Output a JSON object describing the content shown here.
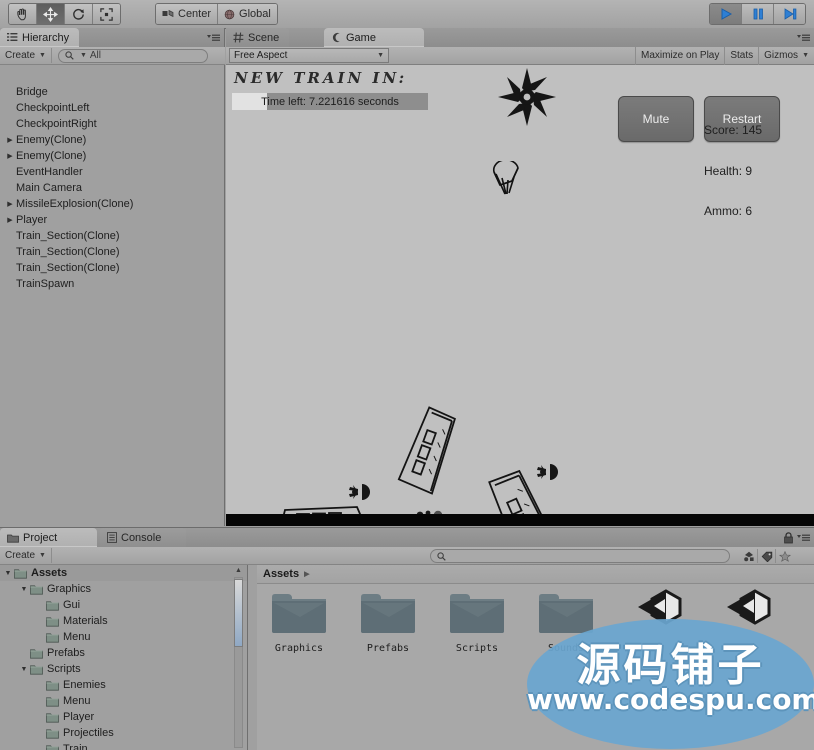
{
  "toolbar": {
    "tools": [
      {
        "name": "hand-tool",
        "icon": "hand-icon",
        "active": false
      },
      {
        "name": "move-tool",
        "icon": "move-icon",
        "active": true
      },
      {
        "name": "rotate-tool",
        "icon": "rotate-icon",
        "active": false
      },
      {
        "name": "scale-tool",
        "icon": "scale-icon",
        "active": false
      }
    ],
    "pivot_label": "Center",
    "space_label": "Global",
    "play_label": "play-icon",
    "pause_label": "pause-icon",
    "step_label": "step-icon"
  },
  "hierarchy": {
    "tab_label": "Hierarchy",
    "create_label": "Create",
    "search_value": "All",
    "items": [
      {
        "label": "Bridge",
        "expandable": false
      },
      {
        "label": "CheckpointLeft",
        "expandable": false
      },
      {
        "label": "CheckpointRight",
        "expandable": false
      },
      {
        "label": "Enemy(Clone)",
        "expandable": true
      },
      {
        "label": "Enemy(Clone)",
        "expandable": true
      },
      {
        "label": "EventHandler",
        "expandable": false
      },
      {
        "label": "Main Camera",
        "expandable": false
      },
      {
        "label": "MissileExplosion(Clone)",
        "expandable": true
      },
      {
        "label": "Player",
        "expandable": true
      },
      {
        "label": "Train_Section(Clone)",
        "expandable": false
      },
      {
        "label": "Train_Section(Clone)",
        "expandable": false
      },
      {
        "label": "Train_Section(Clone)",
        "expandable": false
      },
      {
        "label": "TrainSpawn",
        "expandable": false
      }
    ]
  },
  "gameview": {
    "tabs": [
      {
        "label": "Scene",
        "selected": false
      },
      {
        "label": "Game",
        "selected": true
      }
    ],
    "aspect_label": "Free Aspect",
    "maximize_label": "Maximize on Play",
    "stats_label": "Stats",
    "gizmos_label": "Gizmos",
    "hud": {
      "title": "NEW TRAIN IN:",
      "timer_text": "Time left: 7.221616 seconds",
      "timer_fill_percent": 18,
      "mute_label": "Mute",
      "restart_label": "Restart",
      "score_label": "Score: 145",
      "health_label": "Health: 9",
      "ammo_label": "Ammo: 6"
    }
  },
  "project": {
    "tabs": [
      {
        "label": "Project",
        "selected": true
      },
      {
        "label": "Console",
        "selected": false
      }
    ],
    "create_label": "Create",
    "search_placeholder": "",
    "breadcrumb": "Assets",
    "tree": [
      {
        "label": "Assets",
        "depth": 0,
        "expanded": true,
        "selected": true
      },
      {
        "label": "Graphics",
        "depth": 1,
        "expanded": true,
        "selected": false
      },
      {
        "label": "Gui",
        "depth": 2,
        "expanded": null,
        "selected": false
      },
      {
        "label": "Materials",
        "depth": 2,
        "expanded": null,
        "selected": false
      },
      {
        "label": "Menu",
        "depth": 2,
        "expanded": null,
        "selected": false
      },
      {
        "label": "Prefabs",
        "depth": 1,
        "expanded": null,
        "selected": false
      },
      {
        "label": "Scripts",
        "depth": 1,
        "expanded": true,
        "selected": false
      },
      {
        "label": "Enemies",
        "depth": 2,
        "expanded": null,
        "selected": false
      },
      {
        "label": "Menu",
        "depth": 2,
        "expanded": null,
        "selected": false
      },
      {
        "label": "Player",
        "depth": 2,
        "expanded": null,
        "selected": false
      },
      {
        "label": "Projectiles",
        "depth": 2,
        "expanded": null,
        "selected": false
      },
      {
        "label": "Train",
        "depth": 2,
        "expanded": null,
        "selected": false
      }
    ],
    "assets": [
      {
        "label": "Graphics",
        "kind": "folder"
      },
      {
        "label": "Prefabs",
        "kind": "folder"
      },
      {
        "label": "Scripts",
        "kind": "folder"
      },
      {
        "label": "Sounds",
        "kind": "folder"
      },
      {
        "label": "",
        "kind": "scene"
      },
      {
        "label": "",
        "kind": "scene"
      }
    ]
  },
  "watermark": {
    "chinese": "源码铺子",
    "url": "www.codespu.com"
  },
  "colors": {
    "chrome": "#a0a0a0",
    "game_bg": "#c0c0c0",
    "accent_blue": "#2e7fd4",
    "watermark_blue": "#6aa6d0"
  }
}
